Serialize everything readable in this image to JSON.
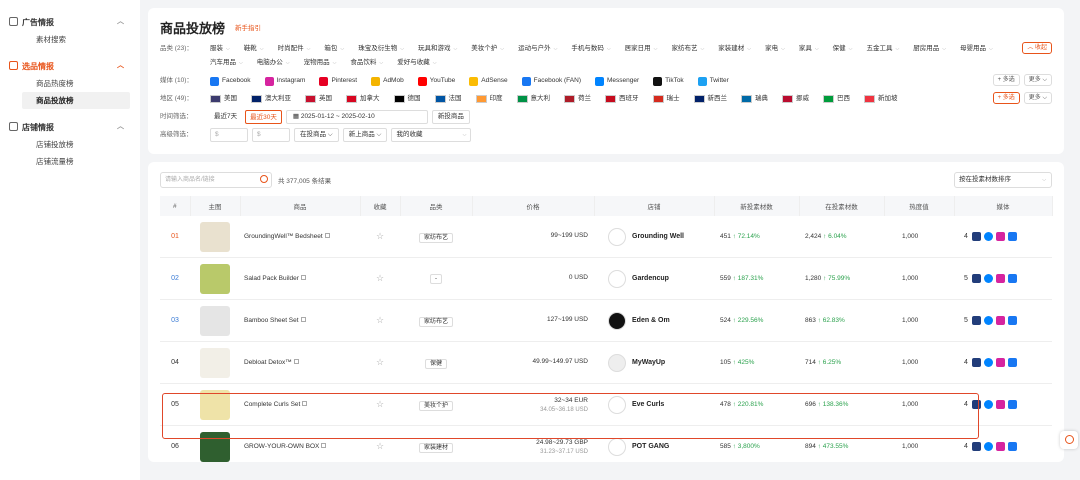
{
  "sidebar": {
    "groups": [
      {
        "label": "广告情报",
        "items": [
          "素材搜索"
        ]
      },
      {
        "label": "选品情报",
        "items": [
          "商品热度榜",
          "商品投放榜"
        ]
      },
      {
        "label": "店铺情报",
        "items": [
          "店铺投放榜",
          "店铺流量榜"
        ]
      }
    ]
  },
  "header": {
    "title": "商品投放榜",
    "guide": "新手指引"
  },
  "filters": {
    "category_label": "品类 (23)：",
    "categories": [
      "服装",
      "鞋靴",
      "时尚配件",
      "箱包",
      "珠宝及衍生物",
      "玩具和游戏",
      "美妆个护",
      "运动与户外",
      "手机与数码",
      "居家日用",
      "家纺布艺",
      "家装建材",
      "家电",
      "家具",
      "保健",
      "五金工具",
      "厨房用品",
      "母婴用品",
      "汽车用品",
      "电脑办公",
      "宠物用品",
      "食品饮料",
      "爱好与收藏"
    ],
    "collapse": "收起",
    "media_label": "媒体 (10)：",
    "media": [
      "Facebook",
      "Instagram",
      "Pinterest",
      "AdMob",
      "YouTube",
      "AdSense",
      "Facebook (FAN)",
      "Messenger",
      "TikTok",
      "Twitter"
    ],
    "multi": "多选",
    "more": "更多",
    "region_label": "地区 (49)：",
    "regions": [
      "美国",
      "澳大利亚",
      "英国",
      "加拿大",
      "德国",
      "法国",
      "印度",
      "意大利",
      "荷兰",
      "西班牙",
      "瑞士",
      "新西兰",
      "瑞典",
      "挪威",
      "巴西",
      "新加坡"
    ],
    "time_label": "时间筛选：",
    "time_opts": [
      "最近7天",
      "最近30天"
    ],
    "date_range": "2025-01-12 ~ 2025-02-10",
    "new_products": "新投商品",
    "adv_label": "高级筛选：",
    "price_from": "$",
    "price_to": "$",
    "in_ad": "在投商品",
    "new_up": "新上商品",
    "fav": "我的收藏"
  },
  "colors": {
    "accent": "#e8541a",
    "up": "#2aa14c"
  },
  "search": {
    "placeholder": "请输入商品名/链接",
    "total": "共 377,005 条结果",
    "sort": "按在投素材数排序"
  },
  "table": {
    "headers": [
      "#",
      "主图",
      "商品",
      "收藏",
      "品类",
      "价格",
      "店铺",
      "新投素材数",
      "在投素材数",
      "热度值",
      "媒体"
    ],
    "rows": [
      {
        "rank": "01",
        "name": "GroundingWell™ Bedsheet",
        "cat": "家纺布艺",
        "price": "99~199 USD",
        "price2": "",
        "store": "Grounding Well",
        "new": "451",
        "new_pct": "↑ 72.14%",
        "act": "2,424",
        "act_pct": "↑ 6.04%",
        "heat": "1,000",
        "media_n": "4"
      },
      {
        "rank": "02",
        "name": "Salad Pack Builder",
        "cat": "-",
        "price": "0 USD",
        "price2": "",
        "store": "Gardencup",
        "new": "559",
        "new_pct": "↑ 187.31%",
        "act": "1,280",
        "act_pct": "↑ 75.99%",
        "heat": "1,000",
        "media_n": "5"
      },
      {
        "rank": "03",
        "name": "Bamboo Sheet Set",
        "cat": "家纺布艺",
        "price": "127~199 USD",
        "price2": "",
        "store": "Eden & Om",
        "new": "524",
        "new_pct": "↑ 229.56%",
        "act": "863",
        "act_pct": "↑ 62.83%",
        "heat": "1,000",
        "media_n": "5"
      },
      {
        "rank": "04",
        "name": "Debloat Detox™",
        "cat": "保健",
        "price": "49.99~149.97 USD",
        "price2": "",
        "store": "MyWayUp",
        "new": "105",
        "new_pct": "↑ 425%",
        "act": "714",
        "act_pct": "↑ 6.25%",
        "heat": "1,000",
        "media_n": "4"
      },
      {
        "rank": "05",
        "name": "Complete Curls Set",
        "cat": "美妆个护",
        "price": "32~34 EUR",
        "price2": "34.05~36.18 USD",
        "store": "Eve Curls",
        "new": "478",
        "new_pct": "↑ 220.81%",
        "act": "696",
        "act_pct": "↑ 138.36%",
        "heat": "1,000",
        "media_n": "4"
      },
      {
        "rank": "06",
        "name": "GROW-YOUR-OWN BOX",
        "cat": "家装建材",
        "price": "24.98~29.73 GBP",
        "price2": "31.23~37.17 USD",
        "store": "POT GANG",
        "new": "585",
        "new_pct": "↑ 3,800%",
        "act": "894",
        "act_pct": "↑ 473.55%",
        "heat": "1,000",
        "media_n": "4"
      }
    ]
  }
}
